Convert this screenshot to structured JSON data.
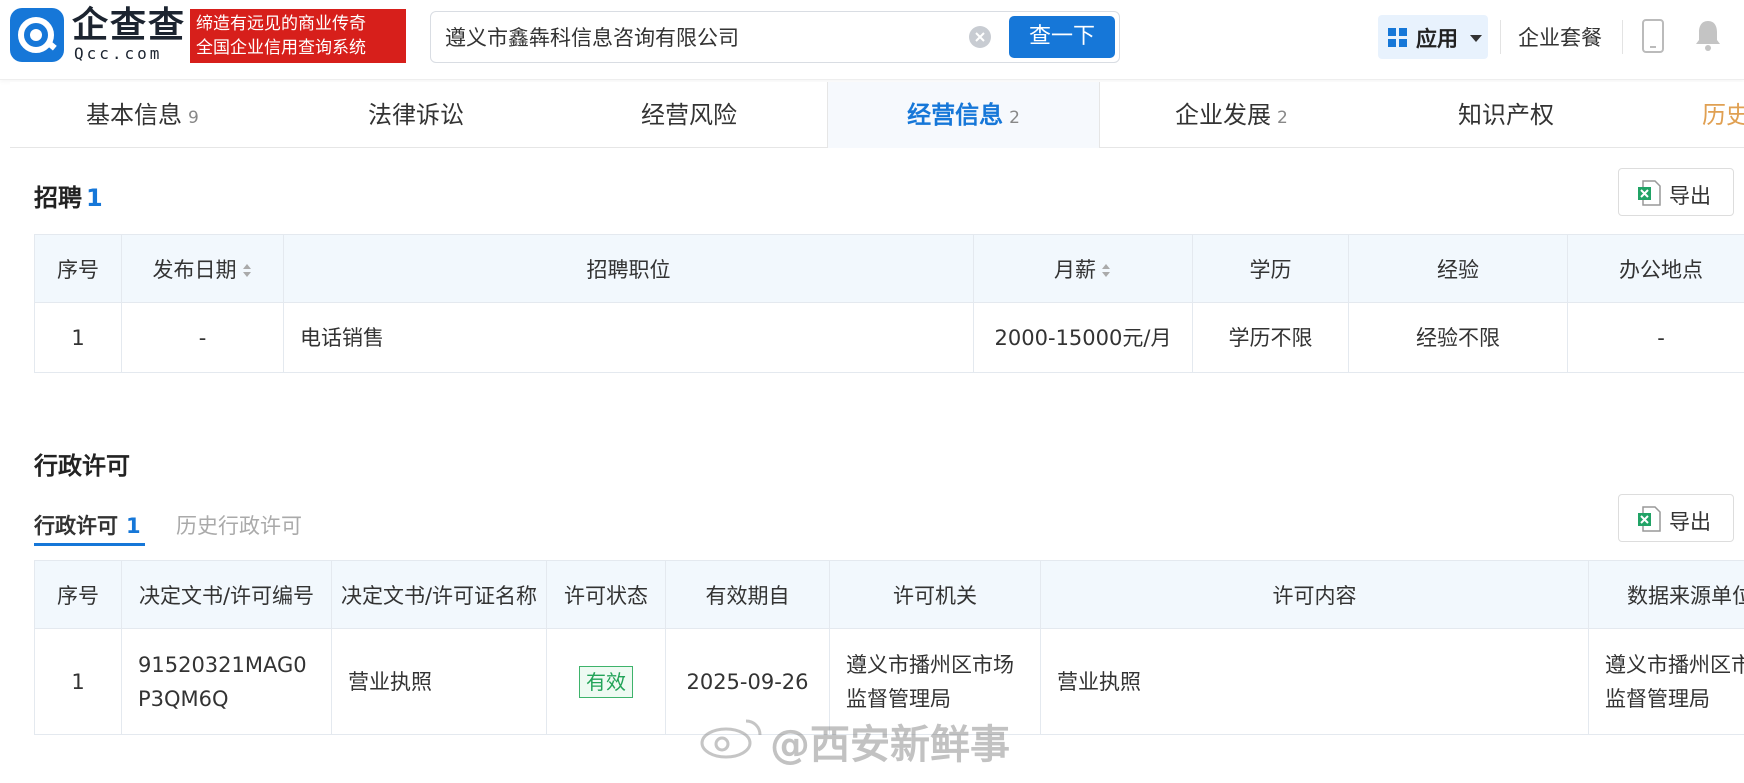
{
  "header": {
    "logo_name": "企查查",
    "logo_domain": "Qcc.com",
    "slogan_line1": "缔造有远见的商业传奇",
    "slogan_line2": "全国企业信用查询系统",
    "search_value": "遵义市鑫犇科信息咨询有限公司",
    "search_button": "查一下",
    "apps_label": "应用",
    "package_label": "企业套餐"
  },
  "tabs": [
    {
      "label": "基本信息",
      "count": "9"
    },
    {
      "label": "法律诉讼",
      "count": ""
    },
    {
      "label": "经营风险",
      "count": ""
    },
    {
      "label": "经营信息",
      "count": "2"
    },
    {
      "label": "企业发展",
      "count": "2"
    },
    {
      "label": "知识产权",
      "count": ""
    },
    {
      "label": "历史",
      "count": ""
    }
  ],
  "recruit": {
    "title": "招聘",
    "count": "1",
    "export_label": "导出",
    "columns": [
      "序号",
      "发布日期",
      "招聘职位",
      "月薪",
      "学历",
      "经验",
      "办公地点"
    ],
    "rows": [
      {
        "no": "1",
        "date": "-",
        "position": "电话销售",
        "salary": "2000-15000元/月",
        "education": "学历不限",
        "experience": "经验不限",
        "location": "-"
      }
    ]
  },
  "license": {
    "title": "行政许可",
    "export_label": "导出",
    "subtab_active": "行政许可",
    "subtab_active_count": "1",
    "subtab_inactive": "历史行政许可",
    "columns": [
      "序号",
      "决定文书/许可编号",
      "决定文书/许可证名称",
      "许可状态",
      "有效期自",
      "许可机关",
      "许可内容",
      "数据来源单位"
    ],
    "rows": [
      {
        "no": "1",
        "number_line1": "91520321MAG0",
        "number_line2": "P3QM6Q",
        "name": "营业执照",
        "status": "有效",
        "valid_from": "2025-09-26",
        "authority_line1": "遵义市播州区市场",
        "authority_line2": "监督管理局",
        "content": "营业执照",
        "source_line1": "遵义市播州区市",
        "source_line2": "监督管理局"
      }
    ]
  },
  "watermark": "@西安新鲜事",
  "colors": {
    "accent": "#1677d8",
    "brand_red": "#d71f1b",
    "valid_green": "#22a358",
    "history_tab": "#e0a052"
  }
}
